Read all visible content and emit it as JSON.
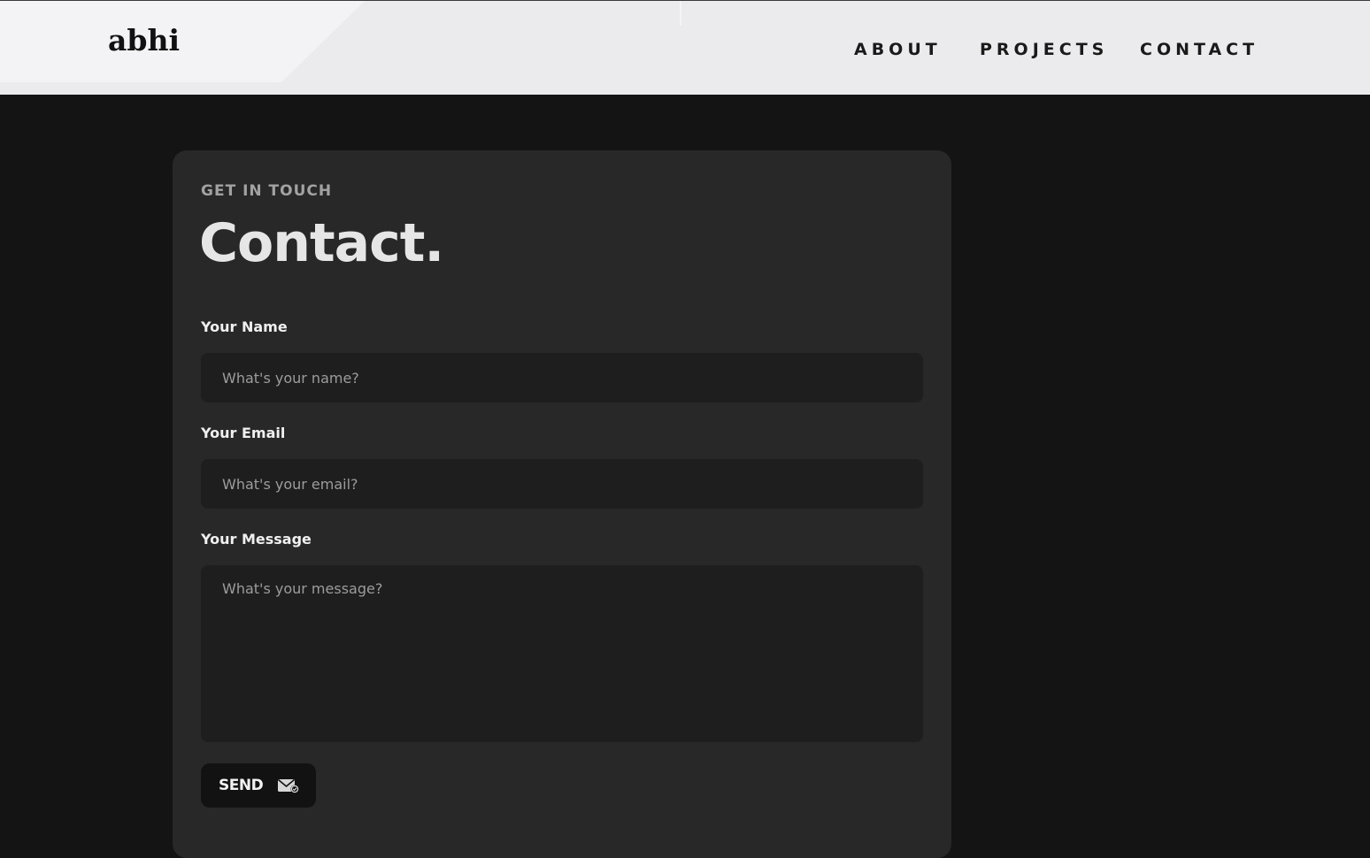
{
  "header": {
    "logo": "abhi",
    "nav": [
      {
        "label": "ABOUT"
      },
      {
        "label": "PROJECTS"
      },
      {
        "label": "CONTACT"
      }
    ]
  },
  "contact": {
    "eyebrow": "GET IN TOUCH",
    "title": "Contact.",
    "fields": {
      "name": {
        "label": "Your Name",
        "placeholder": "What's your name?",
        "value": ""
      },
      "email": {
        "label": "Your Email",
        "placeholder": "What's your email?",
        "value": ""
      },
      "message": {
        "label": "Your Message",
        "placeholder": "What's your message?",
        "value": ""
      }
    },
    "send_label": "SEND",
    "send_icon": "mail-send-icon"
  },
  "colors": {
    "page_bg": "#141414",
    "navbar_bg": "#ebebed",
    "card_bg": "#282828",
    "field_bg": "#1e1e1e",
    "button_bg": "#121212"
  }
}
